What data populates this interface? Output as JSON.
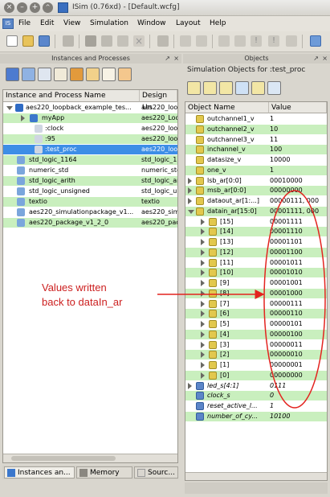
{
  "window": {
    "title": "ISim (0.76xd) - [Default.wcfg]",
    "controls": [
      "×",
      "–",
      "+",
      "^",
      "v"
    ]
  },
  "menu": {
    "items": [
      "File",
      "Edit",
      "View",
      "Simulation",
      "Window",
      "Layout",
      "Help"
    ]
  },
  "left_panel": {
    "header": "Instances and Processes",
    "columns": [
      "Instance and Process Name",
      "Design Un"
    ],
    "rows": [
      {
        "name": "aes220_loopback_example_tes...",
        "unit": "aes220_loop"
      },
      {
        "name": "myApp",
        "unit": "aes220_Loop"
      },
      {
        "name": ":clock",
        "unit": "aes220_loop"
      },
      {
        "name": ":95",
        "unit": "aes220_loop"
      },
      {
        "name": ":test_proc",
        "unit": "aes220_loop"
      },
      {
        "name": "std_logic_1164",
        "unit": "std_logic_11"
      },
      {
        "name": "numeric_std",
        "unit": "numeric_std"
      },
      {
        "name": "std_logic_arith",
        "unit": "std_logic_ar"
      },
      {
        "name": "std_logic_unsigned",
        "unit": "std_logic_ur"
      },
      {
        "name": "textio",
        "unit": "textio"
      },
      {
        "name": "aes220_simulationpackage_v1...",
        "unit": "aes220_simu"
      },
      {
        "name": "aes220_package_v1_2_0",
        "unit": "aes220_pack"
      }
    ],
    "tabs": [
      "Instances an...",
      "Memory",
      "Sourc..."
    ]
  },
  "right_panel": {
    "header": "Objects",
    "subtitle": "Simulation Objects for :test_proc",
    "columns": [
      "Object Name",
      "Value"
    ],
    "rows": [
      {
        "name": "outchannel1_v",
        "value": "1"
      },
      {
        "name": "outchannel2_v",
        "value": "10"
      },
      {
        "name": "outchannel3_v",
        "value": "11"
      },
      {
        "name": "inchannel_v",
        "value": "100"
      },
      {
        "name": "datasize_v",
        "value": "10000"
      },
      {
        "name": "one_v",
        "value": "1"
      },
      {
        "name": "lsb_ar[0:0]",
        "value": "00010000"
      },
      {
        "name": "msb_ar[0:0]",
        "value": "00000000"
      },
      {
        "name": "dataout_ar[1:...]",
        "value": "00000111, 000"
      },
      {
        "name": "datain_ar[15:0]",
        "value": "00001111, 000"
      },
      {
        "name": "[15]",
        "value": "00001111"
      },
      {
        "name": "[14]",
        "value": "00001110"
      },
      {
        "name": "[13]",
        "value": "00001101"
      },
      {
        "name": "[12]",
        "value": "00001100"
      },
      {
        "name": "[11]",
        "value": "00001011"
      },
      {
        "name": "[10]",
        "value": "00001010"
      },
      {
        "name": "[9]",
        "value": "00001001"
      },
      {
        "name": "[8]",
        "value": "00001000"
      },
      {
        "name": "[7]",
        "value": "00000111"
      },
      {
        "name": "[6]",
        "value": "00000110"
      },
      {
        "name": "[5]",
        "value": "00000101"
      },
      {
        "name": "[4]",
        "value": "00000100"
      },
      {
        "name": "[3]",
        "value": "00000011"
      },
      {
        "name": "[2]",
        "value": "00000010"
      },
      {
        "name": "[1]",
        "value": "00000001"
      },
      {
        "name": "[0]",
        "value": "00000000"
      },
      {
        "name": "led_s[4:1]",
        "value": "0111"
      },
      {
        "name": "clock_s",
        "value": "0"
      },
      {
        "name": "reset_active_l...",
        "value": "1"
      },
      {
        "name": "number_of_cy...",
        "value": "10100"
      }
    ]
  },
  "annotation": {
    "line1": "Values written",
    "line2": "back to dataIn_ar",
    "color": "#cc1f1f"
  }
}
